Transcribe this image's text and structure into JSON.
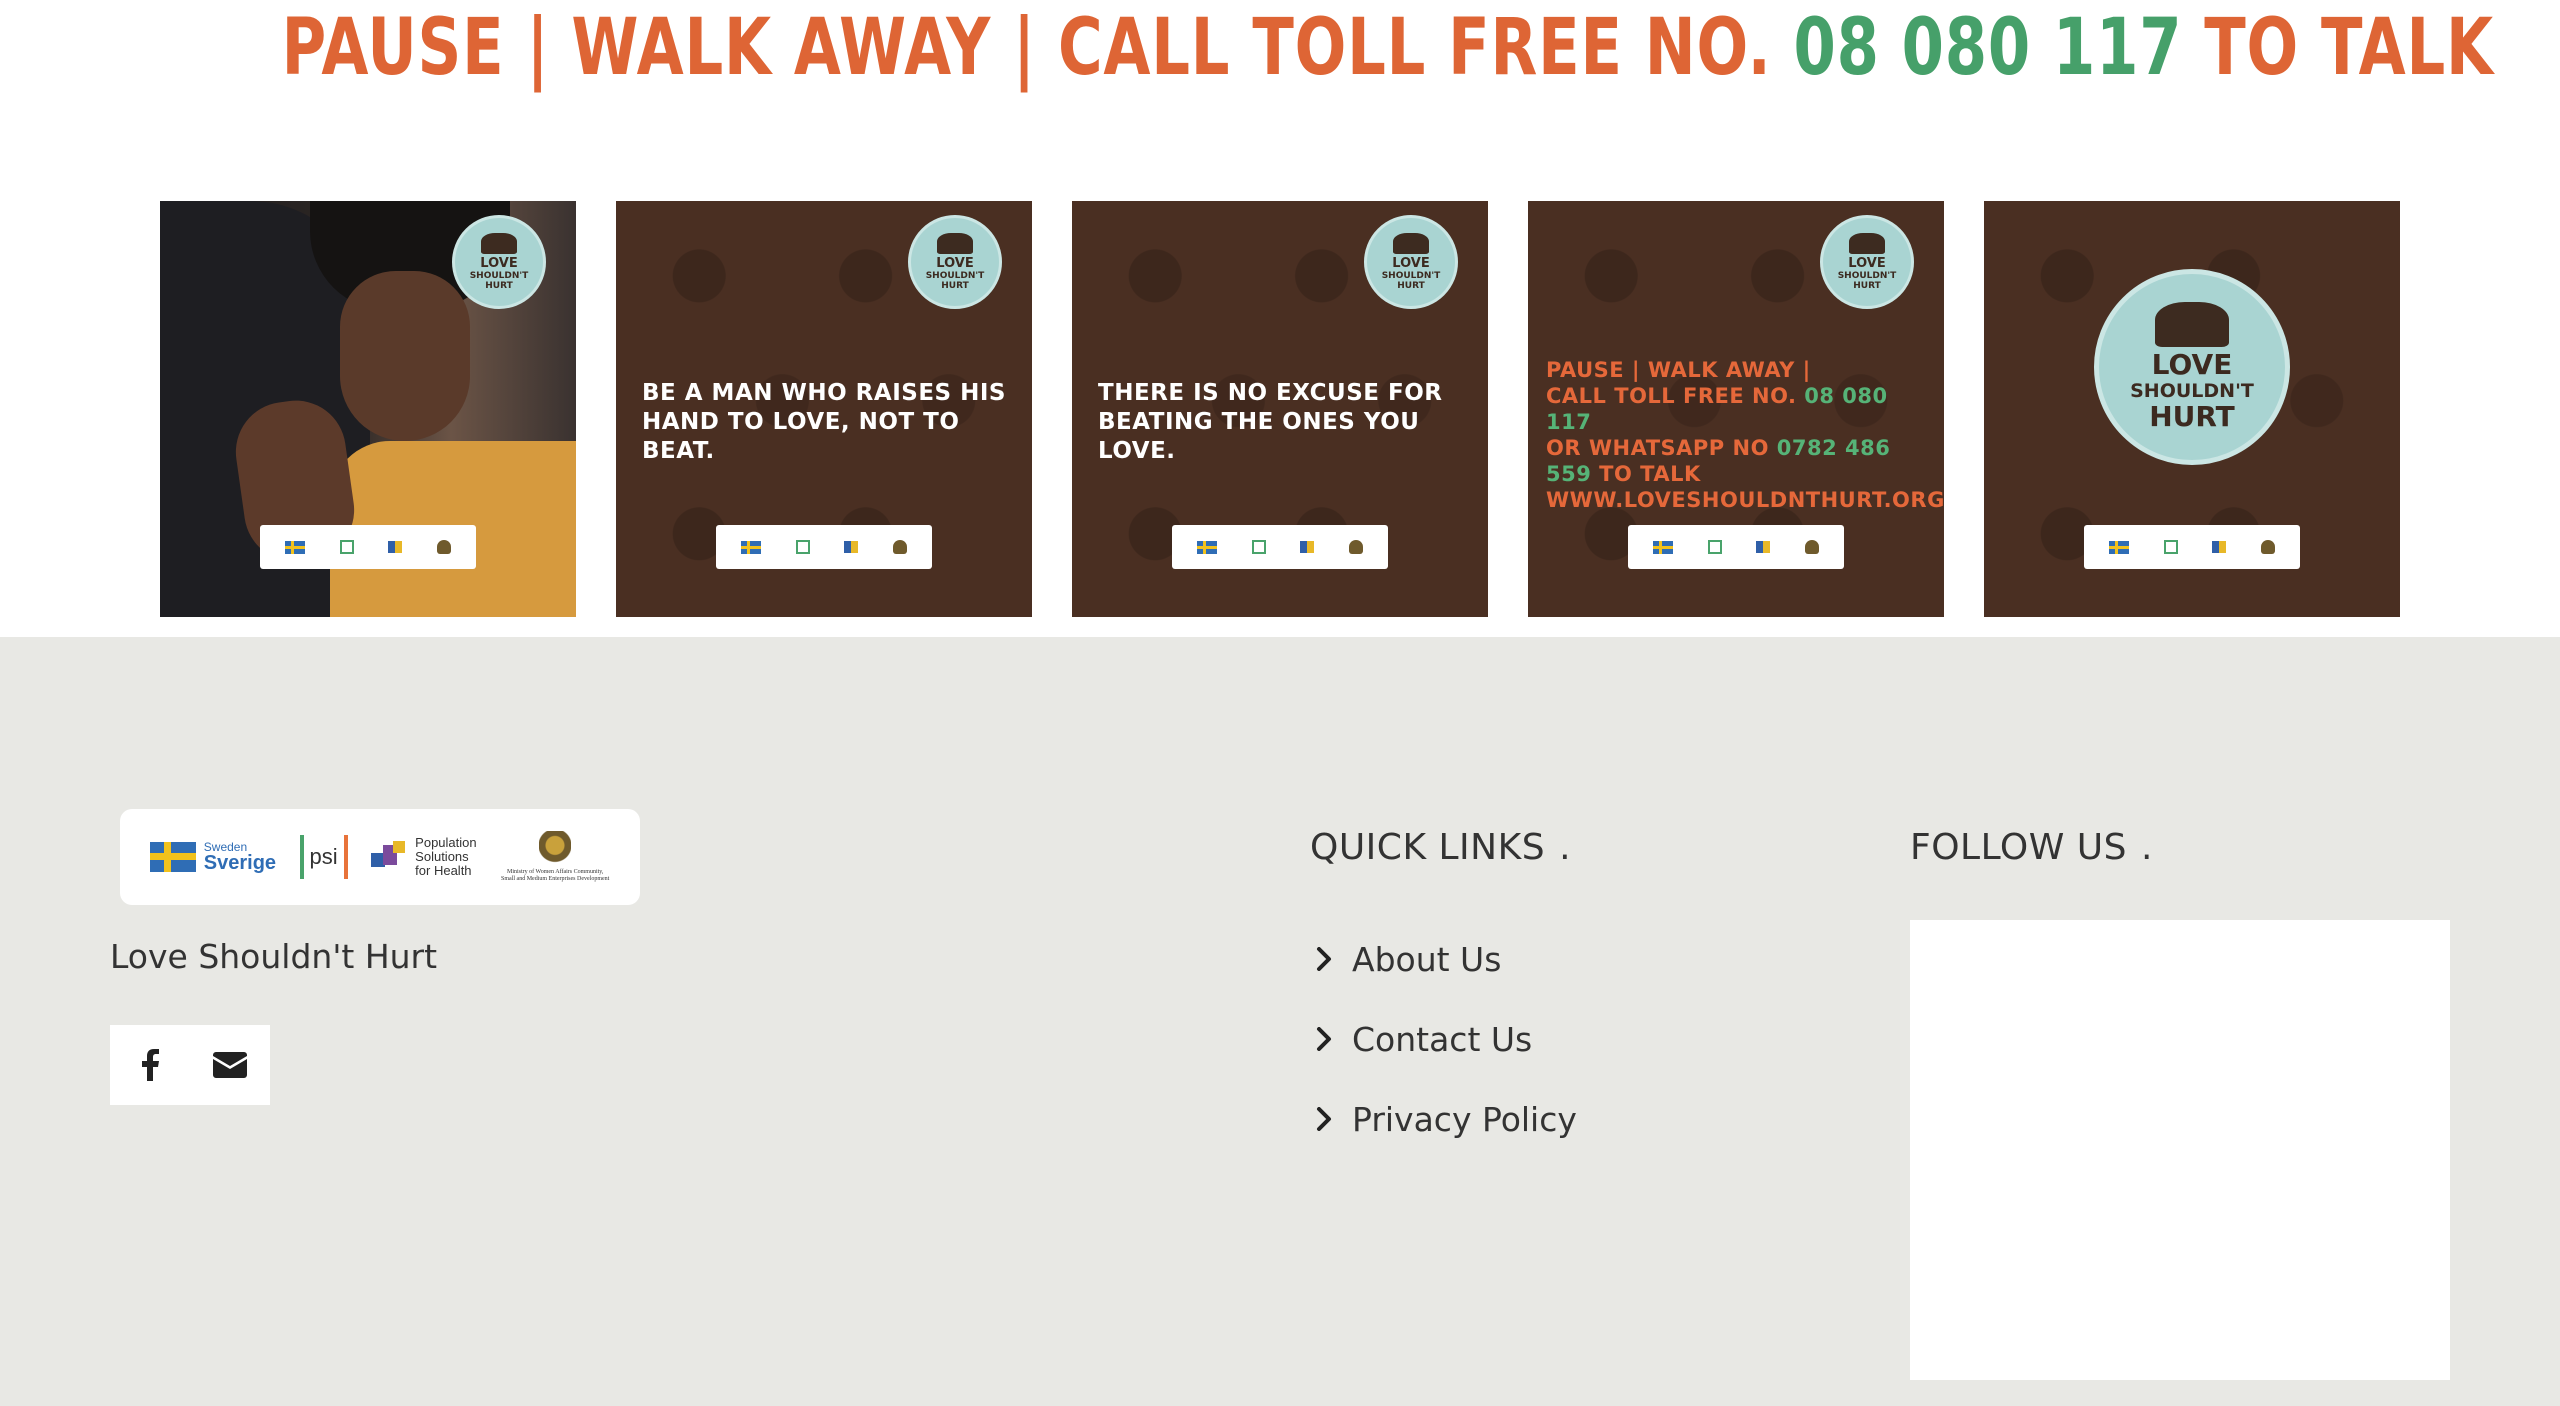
{
  "headline": {
    "part1": "PAUSE | WALK AWAY | CALL TOLL FREE NO.",
    "number": "08 080 117",
    "part2": "TO TALK"
  },
  "gallery": {
    "tiles": [
      {
        "type": "photo",
        "alt": "Woman hugging man"
      },
      {
        "type": "text",
        "text": "BE A MAN WHO RAISES HIS HAND TO LOVE, NOT TO BEAT."
      },
      {
        "type": "text",
        "text": "THERE IS NO EXCUSE FOR BEATING THE ONES YOU LOVE."
      },
      {
        "type": "contact",
        "line1": "PAUSE | WALK AWAY |",
        "line2a": "CALL TOLL FREE NO.",
        "line2b": "08 080 117",
        "line3a": "OR WHATSAPP NO",
        "line3b": "0782 486 559",
        "line3c": "TO TALK",
        "line4": "WWW.LOVESHOULDNTHURT.ORG.ZW"
      },
      {
        "type": "logo"
      }
    ],
    "badge": {
      "love": "LOVE",
      "sub": "SHOULDN'T",
      "hurt": "HURT"
    }
  },
  "footer": {
    "logos": {
      "sweden_small": "Sweden",
      "sweden_big": "Sverige",
      "psi": "psi",
      "psh": [
        "Population",
        "Solutions",
        "for Health"
      ],
      "ministry": "Ministry of Women Affairs Community, Small and Medium Enterprises Development"
    },
    "tagline": "Love Shouldn't Hurt",
    "social": [
      {
        "name": "facebook-icon"
      },
      {
        "name": "envelope-icon"
      }
    ],
    "quick_links": {
      "title": "QUICK LINKS",
      "dot": ".",
      "items": [
        "About Us",
        "Contact Us",
        "Privacy Policy"
      ]
    },
    "follow_us": {
      "title": "FOLLOW US",
      "dot": "."
    }
  },
  "colors": {
    "headline_orange": "#de6535",
    "headline_green": "#46a06a",
    "tile_brown": "#4a2f22",
    "badge_teal": "#a9d4d2",
    "footer_bg": "#e8e8e4"
  }
}
